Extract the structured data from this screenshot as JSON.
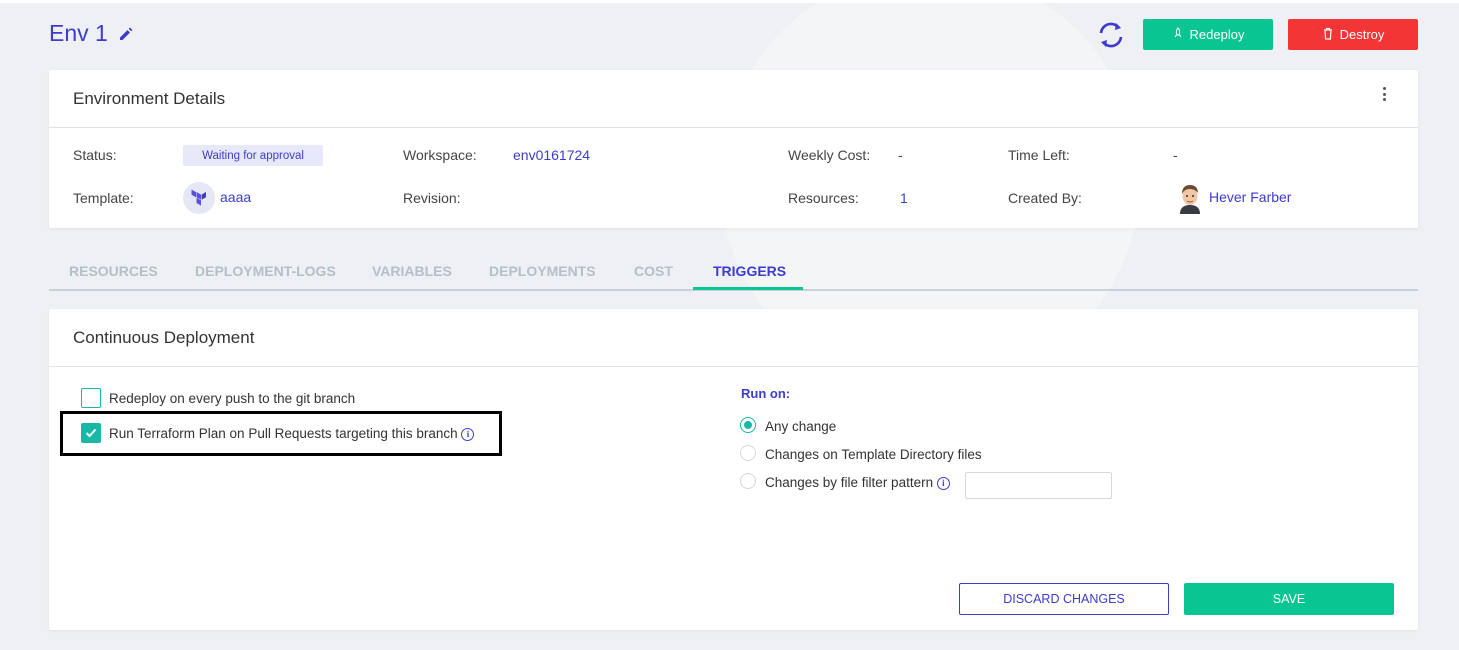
{
  "header": {
    "env_title": "Env 1",
    "redeploy_label": "Redeploy",
    "destroy_label": "Destroy"
  },
  "colors": {
    "accent": "#3c3ccf",
    "success": "#08c591",
    "danger": "#f33535",
    "teal": "#17b8a6"
  },
  "details": {
    "title": "Environment Details",
    "status_label": "Status:",
    "status_value": "Waiting for approval",
    "template_label": "Template:",
    "template_value": "aaaa",
    "workspace_label": "Workspace:",
    "workspace_value": "env0161724",
    "revision_label": "Revision:",
    "revision_value": "",
    "weekly_cost_label": "Weekly Cost:",
    "weekly_cost_value": "-",
    "resources_label": "Resources:",
    "resources_value": "1",
    "time_left_label": "Time Left:",
    "time_left_value": "-",
    "created_by_label": "Created By:",
    "created_by_value": "Hever Farber"
  },
  "tabs": [
    {
      "label": "RESOURCES",
      "active": false
    },
    {
      "label": "DEPLOYMENT-LOGS",
      "active": false
    },
    {
      "label": "VARIABLES",
      "active": false
    },
    {
      "label": "DEPLOYMENTS",
      "active": false
    },
    {
      "label": "COST",
      "active": false
    },
    {
      "label": "TRIGGERS",
      "active": true
    }
  ],
  "cd": {
    "title": "Continuous Deployment",
    "redeploy_on_push_label": "Redeploy on every push to the git branch",
    "redeploy_on_push_checked": false,
    "plan_on_pr_label": "Run Terraform Plan on Pull Requests targeting this branch",
    "plan_on_pr_checked": true,
    "run_on_label": "Run on:",
    "run_on_options": [
      {
        "label": "Any change",
        "selected": true
      },
      {
        "label": "Changes on Template Directory files",
        "selected": false
      },
      {
        "label": "Changes by file filter pattern",
        "selected": false
      }
    ],
    "filter_pattern_value": "",
    "discard_label": "DISCARD CHANGES",
    "save_label": "SAVE"
  }
}
